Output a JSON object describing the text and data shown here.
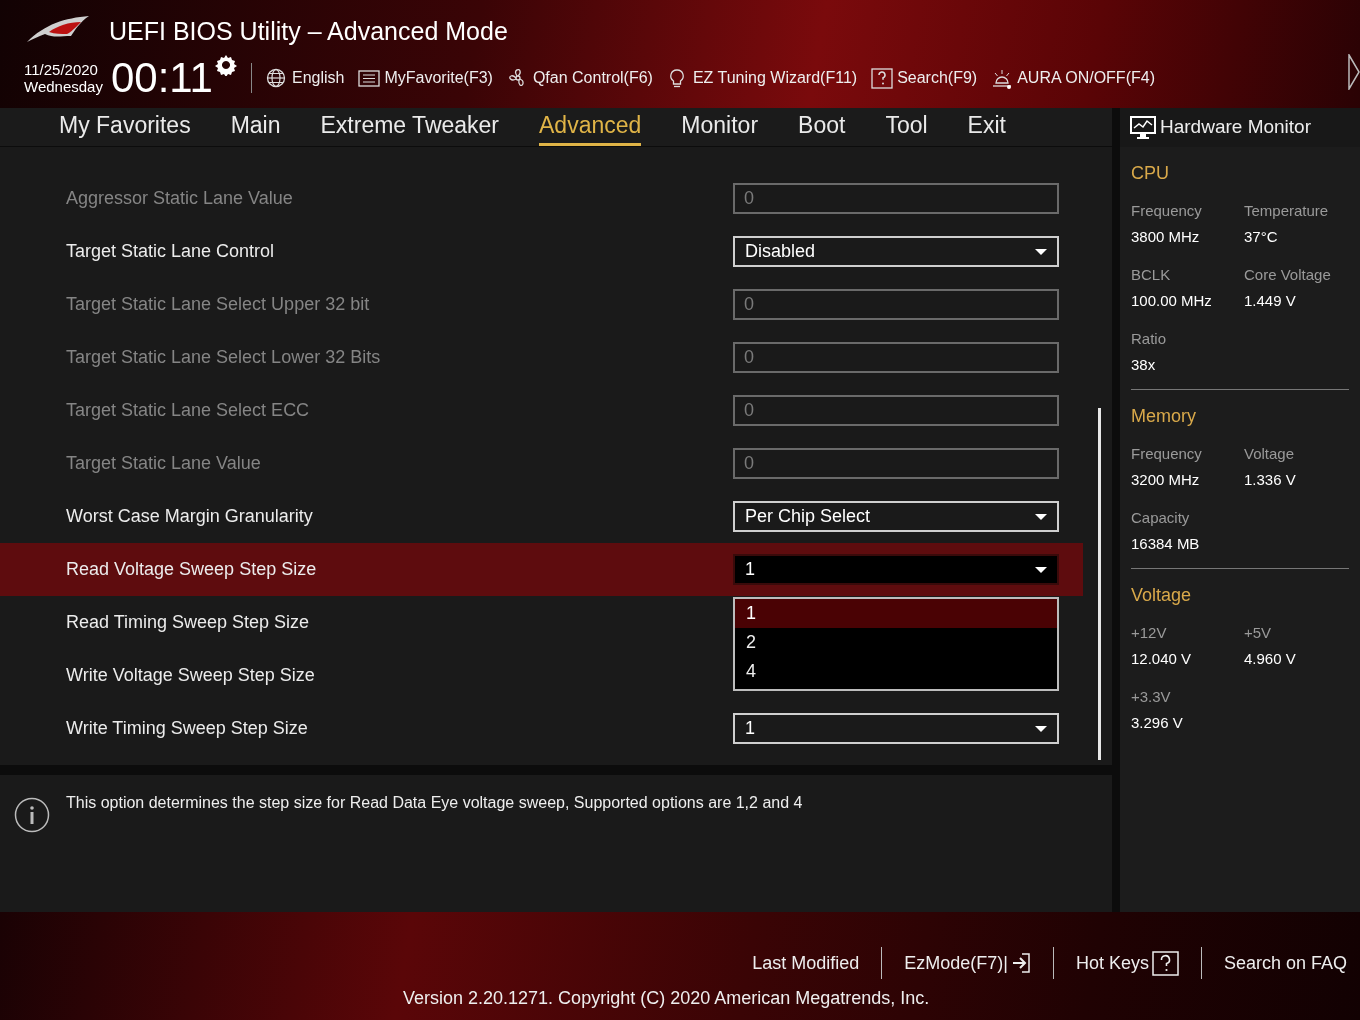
{
  "header": {
    "title": "UEFI BIOS Utility – Advanced Mode",
    "date": "11/25/2020",
    "day": "Wednesday",
    "time": "00:11",
    "tools": [
      {
        "label": "English"
      },
      {
        "label": "MyFavorite(F3)"
      },
      {
        "label": "Qfan Control(F6)"
      },
      {
        "label": "EZ Tuning Wizard(F11)"
      },
      {
        "label": "Search(F9)"
      },
      {
        "label": "AURA ON/OFF(F4)"
      }
    ]
  },
  "tabs": [
    {
      "label": "My Favorites",
      "selected": false
    },
    {
      "label": "Main",
      "selected": false
    },
    {
      "label": "Extreme Tweaker",
      "selected": false
    },
    {
      "label": "Advanced",
      "selected": true
    },
    {
      "label": "Monitor",
      "selected": false
    },
    {
      "label": "Boot",
      "selected": false
    },
    {
      "label": "Tool",
      "selected": false
    },
    {
      "label": "Exit",
      "selected": false
    }
  ],
  "settings": [
    {
      "label": "Aggressor Static Lane Value",
      "kind": "field",
      "disabled": true,
      "value": "0",
      "selected": false
    },
    {
      "label": "Target Static Lane Control",
      "kind": "select",
      "disabled": false,
      "value": "Disabled",
      "selected": false
    },
    {
      "label": "Target Static Lane Select Upper 32 bit",
      "kind": "field",
      "disabled": true,
      "value": "0",
      "selected": false
    },
    {
      "label": "Target Static Lane Select Lower 32 Bits",
      "kind": "field",
      "disabled": true,
      "value": "0",
      "selected": false
    },
    {
      "label": "Target Static Lane Select ECC",
      "kind": "field",
      "disabled": true,
      "value": "0",
      "selected": false
    },
    {
      "label": "Target Static Lane Value",
      "kind": "field",
      "disabled": true,
      "value": "0",
      "selected": false
    },
    {
      "label": "Worst Case Margin Granularity",
      "kind": "select",
      "disabled": false,
      "value": "Per Chip Select",
      "selected": false
    },
    {
      "label": "Read Voltage Sweep Step Size",
      "kind": "select",
      "disabled": false,
      "value": "1",
      "selected": true,
      "expanded": true,
      "options": [
        {
          "label": "1",
          "selected": true
        },
        {
          "label": "2",
          "selected": false
        },
        {
          "label": "4",
          "selected": false
        }
      ]
    },
    {
      "label": "Read Timing Sweep Step Size",
      "kind": "select",
      "disabled": false,
      "selected": false
    },
    {
      "label": "Write Voltage Sweep Step Size",
      "kind": "select",
      "disabled": false,
      "selected": false
    },
    {
      "label": "Write Timing Sweep Step Size",
      "kind": "select",
      "disabled": false,
      "value": "1",
      "selected": false
    }
  ],
  "help": {
    "text": "This option determines the step size for Read Data Eye voltage sweep, Supported options are 1,2 and 4"
  },
  "hardware_monitor": {
    "title": "Hardware Monitor",
    "sections": [
      {
        "title": "CPU",
        "items": [
          {
            "label": "Frequency",
            "value": "3800 MHz"
          },
          {
            "label": "Temperature",
            "value": "37°C"
          },
          {
            "label": "BCLK",
            "value": "100.00 MHz"
          },
          {
            "label": "Core Voltage",
            "value": "1.449 V"
          },
          {
            "label": "Ratio",
            "value": "38x"
          }
        ]
      },
      {
        "title": "Memory",
        "items": [
          {
            "label": "Frequency",
            "value": "3200 MHz"
          },
          {
            "label": "Voltage",
            "value": "1.336 V"
          },
          {
            "label": "Capacity",
            "value": "16384 MB"
          }
        ]
      },
      {
        "title": "Voltage",
        "items": [
          {
            "label": "+12V",
            "value": "12.040 V"
          },
          {
            "label": "+5V",
            "value": "4.960 V"
          },
          {
            "label": "+3.3V",
            "value": "3.296 V"
          }
        ]
      }
    ]
  },
  "footer": {
    "links": [
      {
        "label": "Last Modified"
      },
      {
        "label": "EzMode(F7)|"
      },
      {
        "label": "Hot Keys"
      },
      {
        "label": "Search on FAQ"
      }
    ],
    "version": "Version 2.20.1271. Copyright (C) 2020 American Megatrends, Inc."
  }
}
